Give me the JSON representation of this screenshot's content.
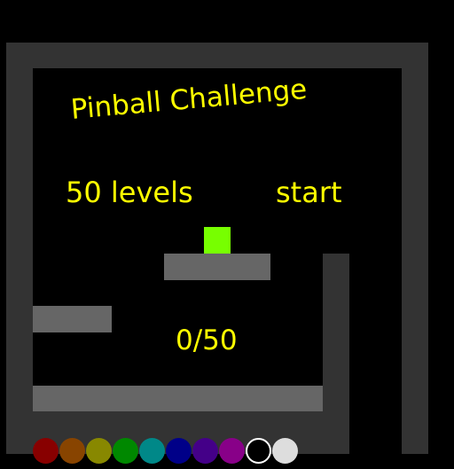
{
  "title": "Pinball Challenge",
  "menu": {
    "levels_label": "50 levels",
    "start_label": "start"
  },
  "progress": "0/50",
  "colors": {
    "background": "#000000",
    "wall": "#333333",
    "platform": "#666666",
    "text": "#ffff00",
    "player": "#77ff00"
  },
  "palette": [
    {
      "name": "dark-red",
      "color": "#880000"
    },
    {
      "name": "brown",
      "color": "#884400"
    },
    {
      "name": "olive",
      "color": "#888800"
    },
    {
      "name": "green",
      "color": "#008800"
    },
    {
      "name": "teal",
      "color": "#008888"
    },
    {
      "name": "navy",
      "color": "#000088"
    },
    {
      "name": "indigo",
      "color": "#440088"
    },
    {
      "name": "purple",
      "color": "#880088"
    },
    {
      "name": "black",
      "color": "#000000",
      "selected": true
    },
    {
      "name": "light-gray",
      "color": "#dddddd"
    }
  ]
}
